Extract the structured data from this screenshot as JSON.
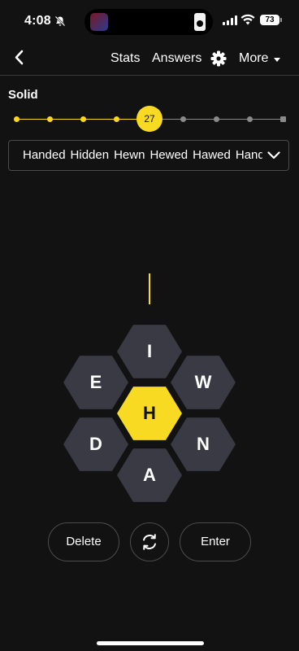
{
  "status_bar": {
    "time": "4:08",
    "battery": "73"
  },
  "nav": {
    "stats": "Stats",
    "answers": "Answers",
    "more": "More"
  },
  "progress": {
    "rank": "Solid",
    "score": "27",
    "level_index": 4,
    "total_levels": 9
  },
  "found_words": [
    "Handed",
    "Hidden",
    "Hewn",
    "Hewed",
    "Hawed",
    "Handed"
  ],
  "hive": {
    "center": "H",
    "top": "I",
    "top_left": "E",
    "top_right": "W",
    "bottom_left": "D",
    "bottom_right": "N",
    "bottom": "A"
  },
  "colors": {
    "accent": "#f7da21",
    "outer_hex": "#3a3a44",
    "background": "#121212"
  },
  "buttons": {
    "delete": "Delete",
    "enter": "Enter"
  },
  "icons": {
    "back": "chevron-left-icon",
    "settings": "gear-icon",
    "more": "caret-down-icon",
    "expand": "chevron-down-icon",
    "shuffle": "shuffle-icon"
  }
}
